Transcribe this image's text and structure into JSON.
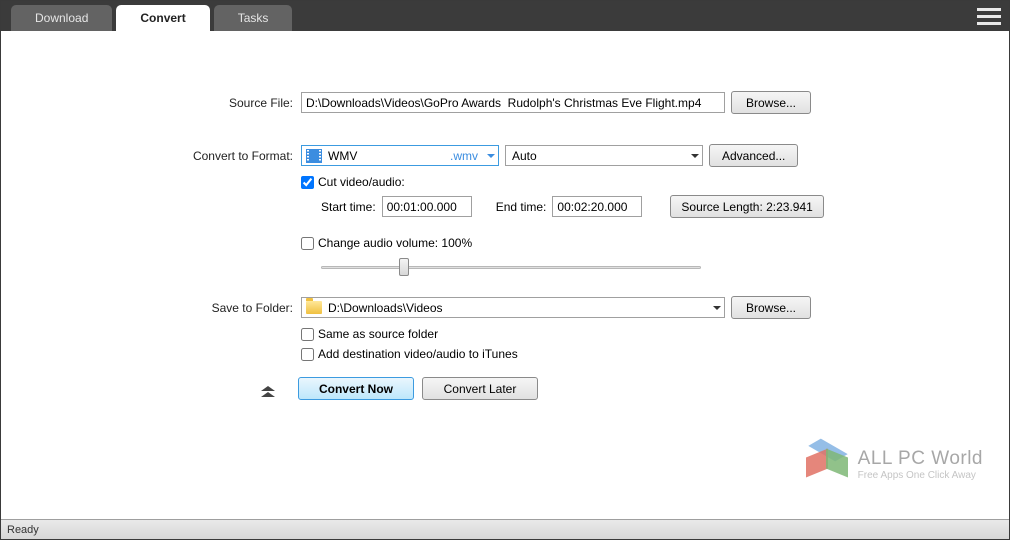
{
  "tabs": {
    "download": "Download",
    "convert": "Convert",
    "tasks": "Tasks"
  },
  "labels": {
    "source_file": "Source File:",
    "convert_to_format": "Convert to Format:",
    "save_to_folder": "Save to Folder:",
    "cut_video_audio": "Cut video/audio:",
    "start_time": "Start time:",
    "end_time": "End time:",
    "change_audio_volume": "Change audio volume: 100%",
    "same_as_source": "Same as source folder",
    "add_to_itunes": "Add destination video/audio to iTunes"
  },
  "buttons": {
    "browse": "Browse...",
    "advanced": "Advanced...",
    "source_length": "Source Length: 2:23.941",
    "convert_now": "Convert Now",
    "convert_later": "Convert Later"
  },
  "values": {
    "source_file": "D:\\Downloads\\Videos\\GoPro Awards  Rudolph's Christmas Eve Flight.mp4",
    "format_name": "WMV",
    "format_ext": ".wmv",
    "quality": "Auto",
    "start_time": "00:01:00.000",
    "end_time": "00:02:20.000",
    "save_folder": "D:\\Downloads\\Videos",
    "cut_checked": true,
    "change_volume_checked": false,
    "same_as_source_checked": false,
    "add_itunes_checked": false
  },
  "watermark": {
    "title": "ALL PC World",
    "subtitle": "Free Apps One Click Away"
  },
  "status": "Ready"
}
